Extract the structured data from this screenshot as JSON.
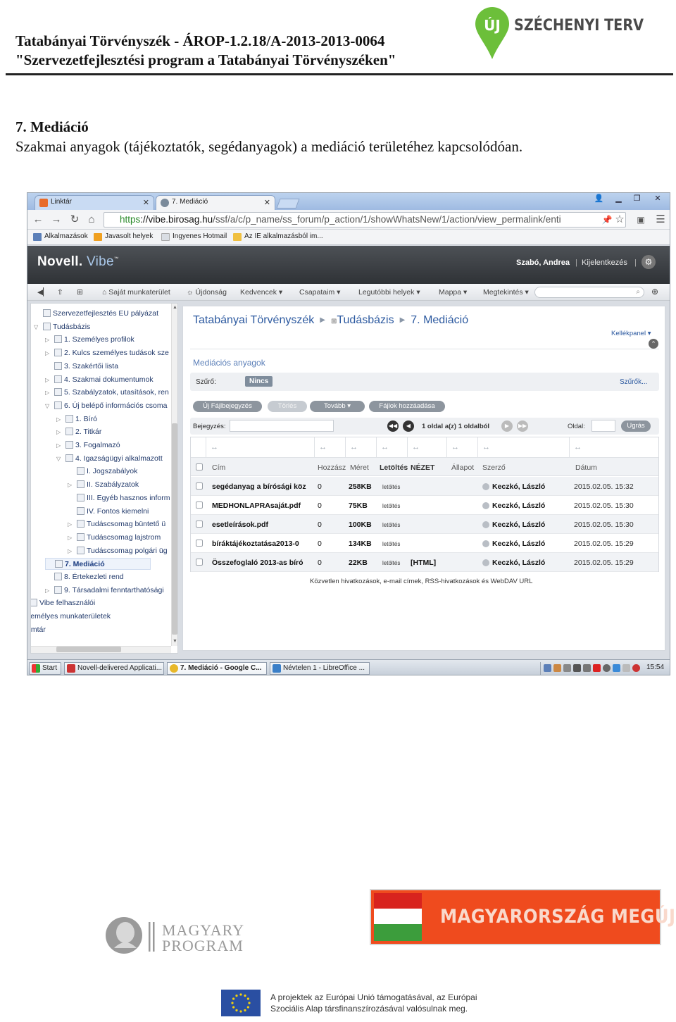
{
  "doc": {
    "header_line1": "Tatabányai Törvényszék - ÁROP-1.2.18/A-2013-2013-0064",
    "header_line2": "\"Szervezetfejlesztési program a Tatabányai Törvényszéken\"",
    "logo_uj": "ÚJ",
    "logo_szechenyi": "SZÉCHENYI TERV",
    "section_title": "7. Mediáció",
    "section_subtitle": "Szakmai anyagok (tájékoztatók, segédanyagok) a mediáció területéhez kapcsolódóan."
  },
  "browser": {
    "tabs": [
      {
        "label": "Linktár",
        "color": "#e86b2a"
      },
      {
        "label": "7. Mediáció",
        "color": "#7a8a9a"
      }
    ],
    "url_scheme": "https",
    "url_host": "://vibe.birosag.hu",
    "url_path": "/ssf/a/c/p_name/ss_forum/p_action/1/showWhatsNew/1/action/view_permalink/enti",
    "bookmarks": [
      {
        "label": "Alkalmazások",
        "color": "#5b7fb8"
      },
      {
        "label": "Javasolt helyek",
        "color": "#f0a020"
      },
      {
        "label": "Ingyenes Hotmail",
        "color": "#d9dde3"
      },
      {
        "label": "Az IE alkalmazásból im...",
        "color": "#f0c040"
      }
    ]
  },
  "vibe": {
    "logo_main": "Novell.",
    "logo_sub": "Vibe",
    "logo_tm": "™",
    "user": "Szabó, Andrea",
    "logout": "Kijelentkezés",
    "toolbar": [
      "Saját munkaterület",
      "Újdonság",
      "Kedvencek",
      "Csapataim",
      "Legutóbbi helyek",
      "Mappa",
      "Megtekintés"
    ],
    "tree": [
      {
        "label": "Szervezetfejlesztés EU pályázat",
        "indent": 0,
        "exp": ""
      },
      {
        "label": "Tudásbázis",
        "indent": 0,
        "exp": "▽"
      },
      {
        "label": "1. Személyes profilok",
        "indent": 1,
        "exp": "▷"
      },
      {
        "label": "2. Kulcs személyes tudások sze",
        "indent": 1,
        "exp": "▷"
      },
      {
        "label": "3. Szakértői lista",
        "indent": 1,
        "exp": ""
      },
      {
        "label": "4. Szakmai dokumentumok",
        "indent": 1,
        "exp": "▷"
      },
      {
        "label": "5. Szabályzatok, utasítások, ren",
        "indent": 1,
        "exp": "▷"
      },
      {
        "label": "6. Új belépő információs csoma",
        "indent": 1,
        "exp": "▽"
      },
      {
        "label": "1. Bíró",
        "indent": 2,
        "exp": "▷"
      },
      {
        "label": "2. Titkár",
        "indent": 2,
        "exp": "▷"
      },
      {
        "label": "3. Fogalmazó",
        "indent": 2,
        "exp": "▷"
      },
      {
        "label": "4. Igazságügyi alkalmazott",
        "indent": 2,
        "exp": "▽"
      },
      {
        "label": "I. Jogszabályok",
        "indent": 3,
        "exp": ""
      },
      {
        "label": "II. Szabályzatok",
        "indent": 3,
        "exp": "▷"
      },
      {
        "label": "III. Egyéb hasznos inform",
        "indent": 3,
        "exp": ""
      },
      {
        "label": "IV. Fontos kiemelni",
        "indent": 3,
        "exp": ""
      },
      {
        "label": "Tudáscsomag büntető ü",
        "indent": 3,
        "exp": "▷"
      },
      {
        "label": "Tudáscsomag lajstrom",
        "indent": 3,
        "exp": "▷"
      },
      {
        "label": "Tudáscsomag polgári üg",
        "indent": 3,
        "exp": "▷"
      },
      {
        "label": "7. Mediáció",
        "indent": 1,
        "exp": "",
        "selected": true
      },
      {
        "label": "8. Értekezleti rend",
        "indent": 1,
        "exp": ""
      },
      {
        "label": "9. Társadalmi fenntarthatósági",
        "indent": 1,
        "exp": "▷"
      },
      {
        "label": "Vibe felhasználói",
        "indent": -1,
        "exp": ""
      },
      {
        "label": "zemélyes munkaterületek",
        "indent": -2,
        "exp": ""
      },
      {
        "label": "omtár",
        "indent": -2,
        "exp": ""
      }
    ],
    "breadcrumb": [
      "Tatabányai Törvényszék",
      "Tudásbázis",
      "7. Mediáció"
    ],
    "kellekpanel": "Kellékpanel",
    "folder_title": "Mediációs anyagok",
    "filter_label": "Szűrő:",
    "filter_value": "Nincs",
    "filter_more": "Szűrők...",
    "buttons": [
      "Új Fájlbejegyzés",
      "Törlés",
      "Tovább",
      "Fájlok hozzáadása"
    ],
    "pager": {
      "entry_label": "Bejegyzés:",
      "info": "1 oldal a(z) 1 oldalból",
      "page_label": "Oldal:",
      "go": "Ugrás"
    },
    "columns": [
      "Cím",
      "Hozzász",
      "Méret",
      "Letöltés",
      "NÉZET",
      "Állapot",
      "Szerző",
      "Dátum"
    ],
    "rows": [
      {
        "title": "segédanyag a bírósági köz",
        "comments": "0",
        "size": "258KB",
        "download": "letöltés",
        "view": "",
        "author": "Keczkó, László",
        "date": "2015.02.05. 15:32"
      },
      {
        "title": "MEDHONLAPRAsaját.pdf",
        "comments": "0",
        "size": "75KB",
        "download": "letöltés",
        "view": "",
        "author": "Keczkó, László",
        "date": "2015.02.05. 15:30"
      },
      {
        "title": "esetleírások.pdf",
        "comments": "0",
        "size": "100KB",
        "download": "letöltés",
        "view": "",
        "author": "Keczkó, László",
        "date": "2015.02.05. 15:30"
      },
      {
        "title": "bíráktájékoztatása2013-0",
        "comments": "0",
        "size": "134KB",
        "download": "letöltés",
        "view": "",
        "author": "Keczkó, László",
        "date": "2015.02.05. 15:29"
      },
      {
        "title": "Összefoglaló 2013-as bíró",
        "comments": "0",
        "size": "22KB",
        "download": "letöltés",
        "view": "[HTML]",
        "author": "Keczkó, László",
        "date": "2015.02.05. 15:29"
      }
    ],
    "links_footer": "Közvetlen hivatkozások, e-mail címek, RSS-hivatkozások és WebDAV URL"
  },
  "taskbar": {
    "start": "Start",
    "tasks": [
      "Novell-delivered Applicati...",
      "7. Mediáció - Google C...",
      "Névtelen 1 - LibreOffice ..."
    ],
    "clock": "15:54"
  },
  "footer": {
    "magyary_line1": "MAGYARY",
    "magyary_line2": "PROGRAM",
    "hu_banner": "MAGYARORSZÁG MEGÚJUL",
    "eu_line1": "A projektek az Európai Unió támogatásával, az Európai",
    "eu_line2": "Szociális Alap társfinanszírozásával valósulnak meg."
  },
  "colors": {
    "vibe_link": "#2d5aa0",
    "hu_orange": "#ef4b1e",
    "szechenyi_green": "#6cbf3a",
    "eu_blue": "#2a4fa2"
  }
}
